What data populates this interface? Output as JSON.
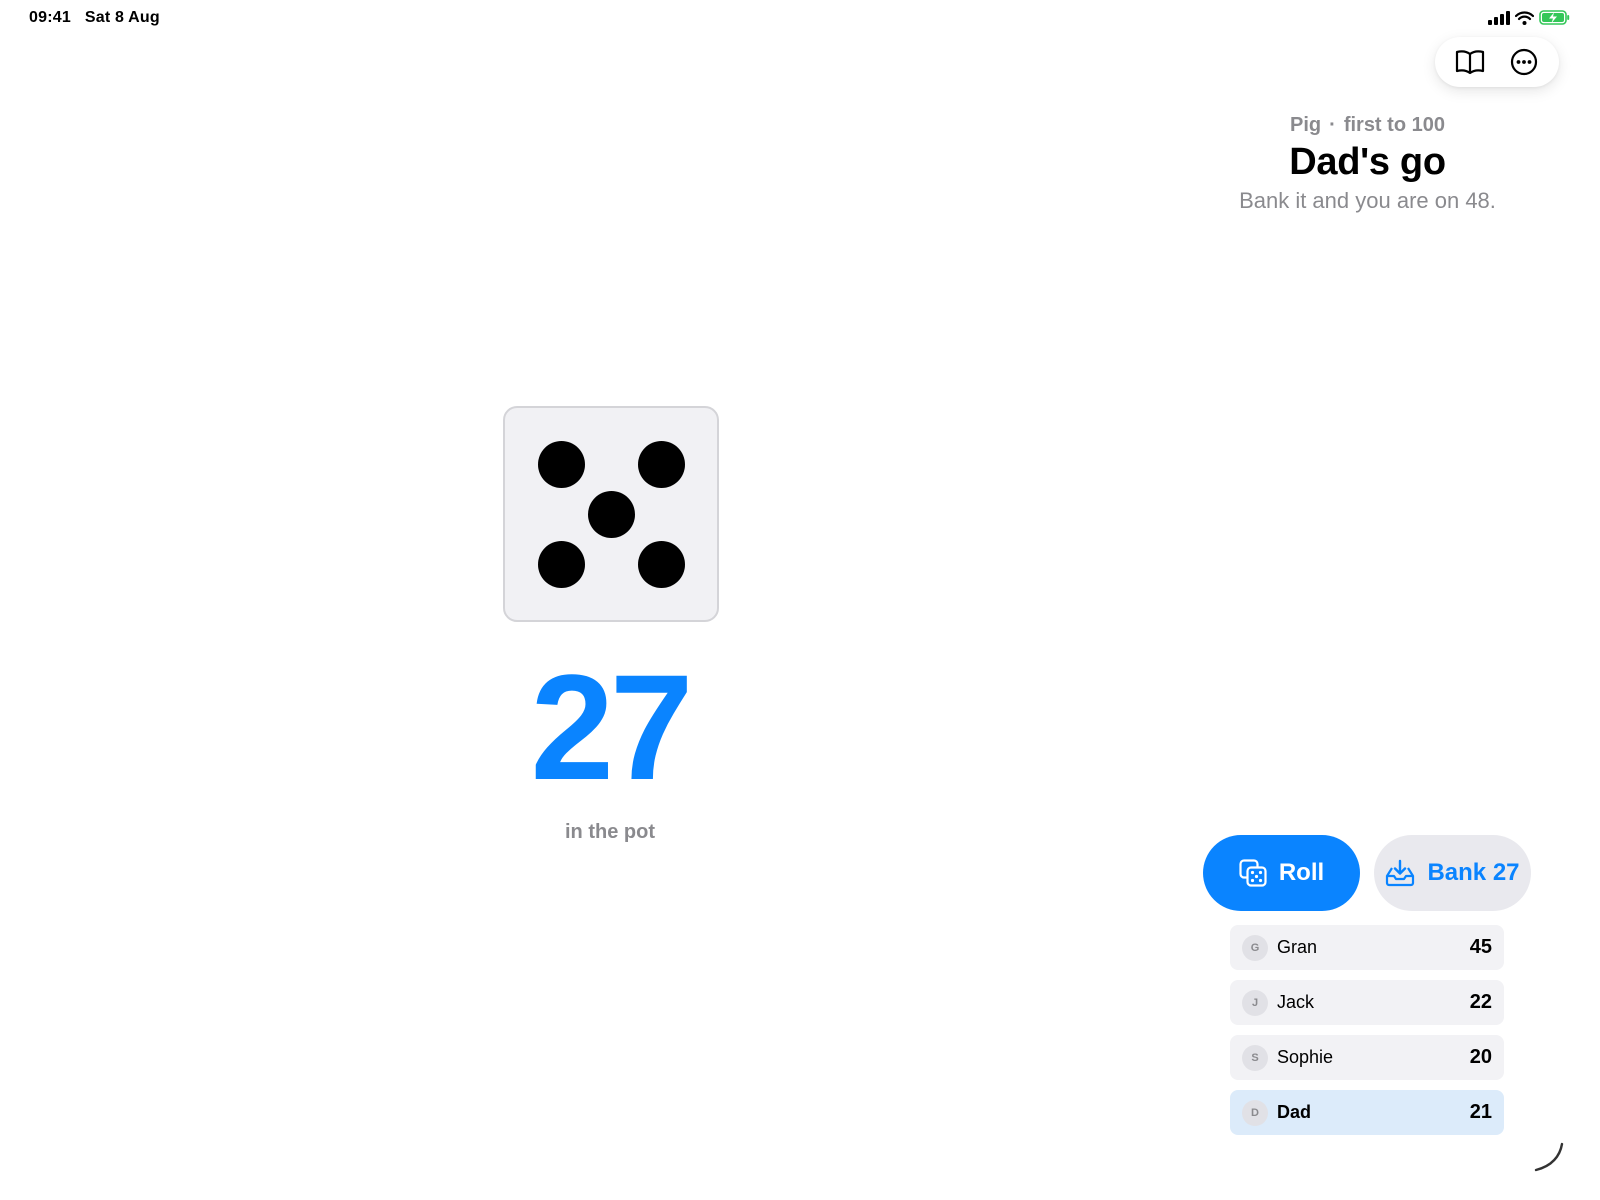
{
  "status_bar": {
    "time": "09:41",
    "date": "Sat 8 Aug",
    "battery_color": "#34c759"
  },
  "toolbar": {
    "rules_icon": "book-icon",
    "more_icon": "ellipsis-circle-icon"
  },
  "header": {
    "game_name": "Pig",
    "separator": "·",
    "goal": "first to 100",
    "turn_title": "Dad's go",
    "hint": "Bank it and you are on 48."
  },
  "die": {
    "face_value": 5
  },
  "pot": {
    "value": "27",
    "label": "in the pot"
  },
  "actions": {
    "roll_label": "Roll",
    "roll_icon": "dice-icon",
    "bank_label": "Bank 27",
    "bank_icon": "tray-download-icon"
  },
  "players": [
    {
      "initial": "G",
      "name": "Gran",
      "score": "45",
      "active": false
    },
    {
      "initial": "J",
      "name": "Jack",
      "score": "22",
      "active": false
    },
    {
      "initial": "S",
      "name": "Sophie",
      "score": "20",
      "active": false
    },
    {
      "initial": "D",
      "name": "Dad",
      "score": "21",
      "active": true
    }
  ],
  "colors": {
    "accent": "#0a84ff",
    "secondary_text": "#8a8a8e",
    "active_row": "#dcebfa",
    "row": "#f2f2f5"
  }
}
